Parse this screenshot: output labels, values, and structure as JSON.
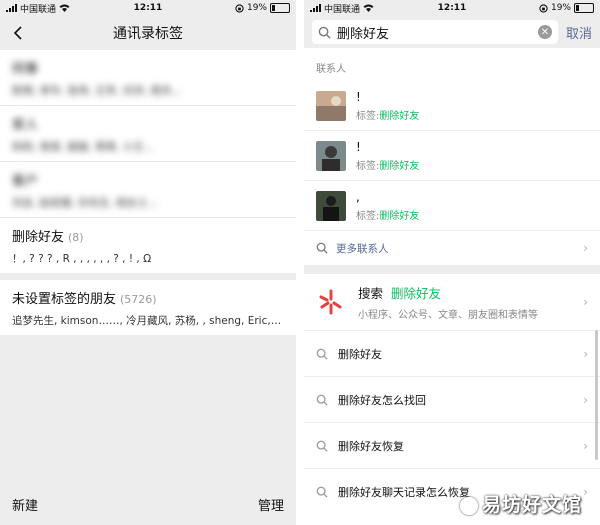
{
  "status": {
    "carrier": "中国联通",
    "time": "12:11",
    "battery": "19%"
  },
  "left": {
    "nav_title": "通讯录标签",
    "blurred_tags": [
      {
        "name": "同事",
        "members": "陈明, 李华, 张伟, 王芳, 刘洋, 周杰..."
      },
      {
        "name": "家人",
        "members": "妈妈, 爸爸, 姐姐, 哥哥, 小王..."
      },
      {
        "name": "客户",
        "members": "刘总, 赵经理, 孙先生, 钱女士..."
      }
    ],
    "tags": [
      {
        "name": "删除好友",
        "count": "(8)",
        "members": "！, ? ? ? , R , , , , , , ? , ! , Ω"
      },
      {
        "name": "未设置标签的朋友",
        "count": "(5726)",
        "members": "追梦先生, kimson……, 冷月藏风, 苏杨, , sheng, Eric,…"
      }
    ],
    "bottom": {
      "new_label": "新建",
      "manage_label": "管理"
    }
  },
  "right": {
    "search": {
      "value": "删除好友",
      "cancel_label": "取消"
    },
    "contacts_section": "联系人",
    "contacts": [
      {
        "name": "!",
        "tag_prefix": "标签:",
        "tag": "删除好友"
      },
      {
        "name": "!",
        "tag_prefix": "标签:",
        "tag": "删除好友"
      },
      {
        "name": ",",
        "tag_prefix": "标签:",
        "tag": "删除好友"
      }
    ],
    "more_contacts": "更多联系人",
    "search_mp": {
      "prefix": "搜索",
      "query": "删除好友",
      "desc": "小程序、公众号、文章、朋友圈和表情等"
    },
    "suggestions": [
      "删除好友",
      "删除好友怎么找回",
      "删除好友恢复",
      "删除好友聊天记录怎么恢复"
    ],
    "watermark": "易坊好文馆"
  }
}
